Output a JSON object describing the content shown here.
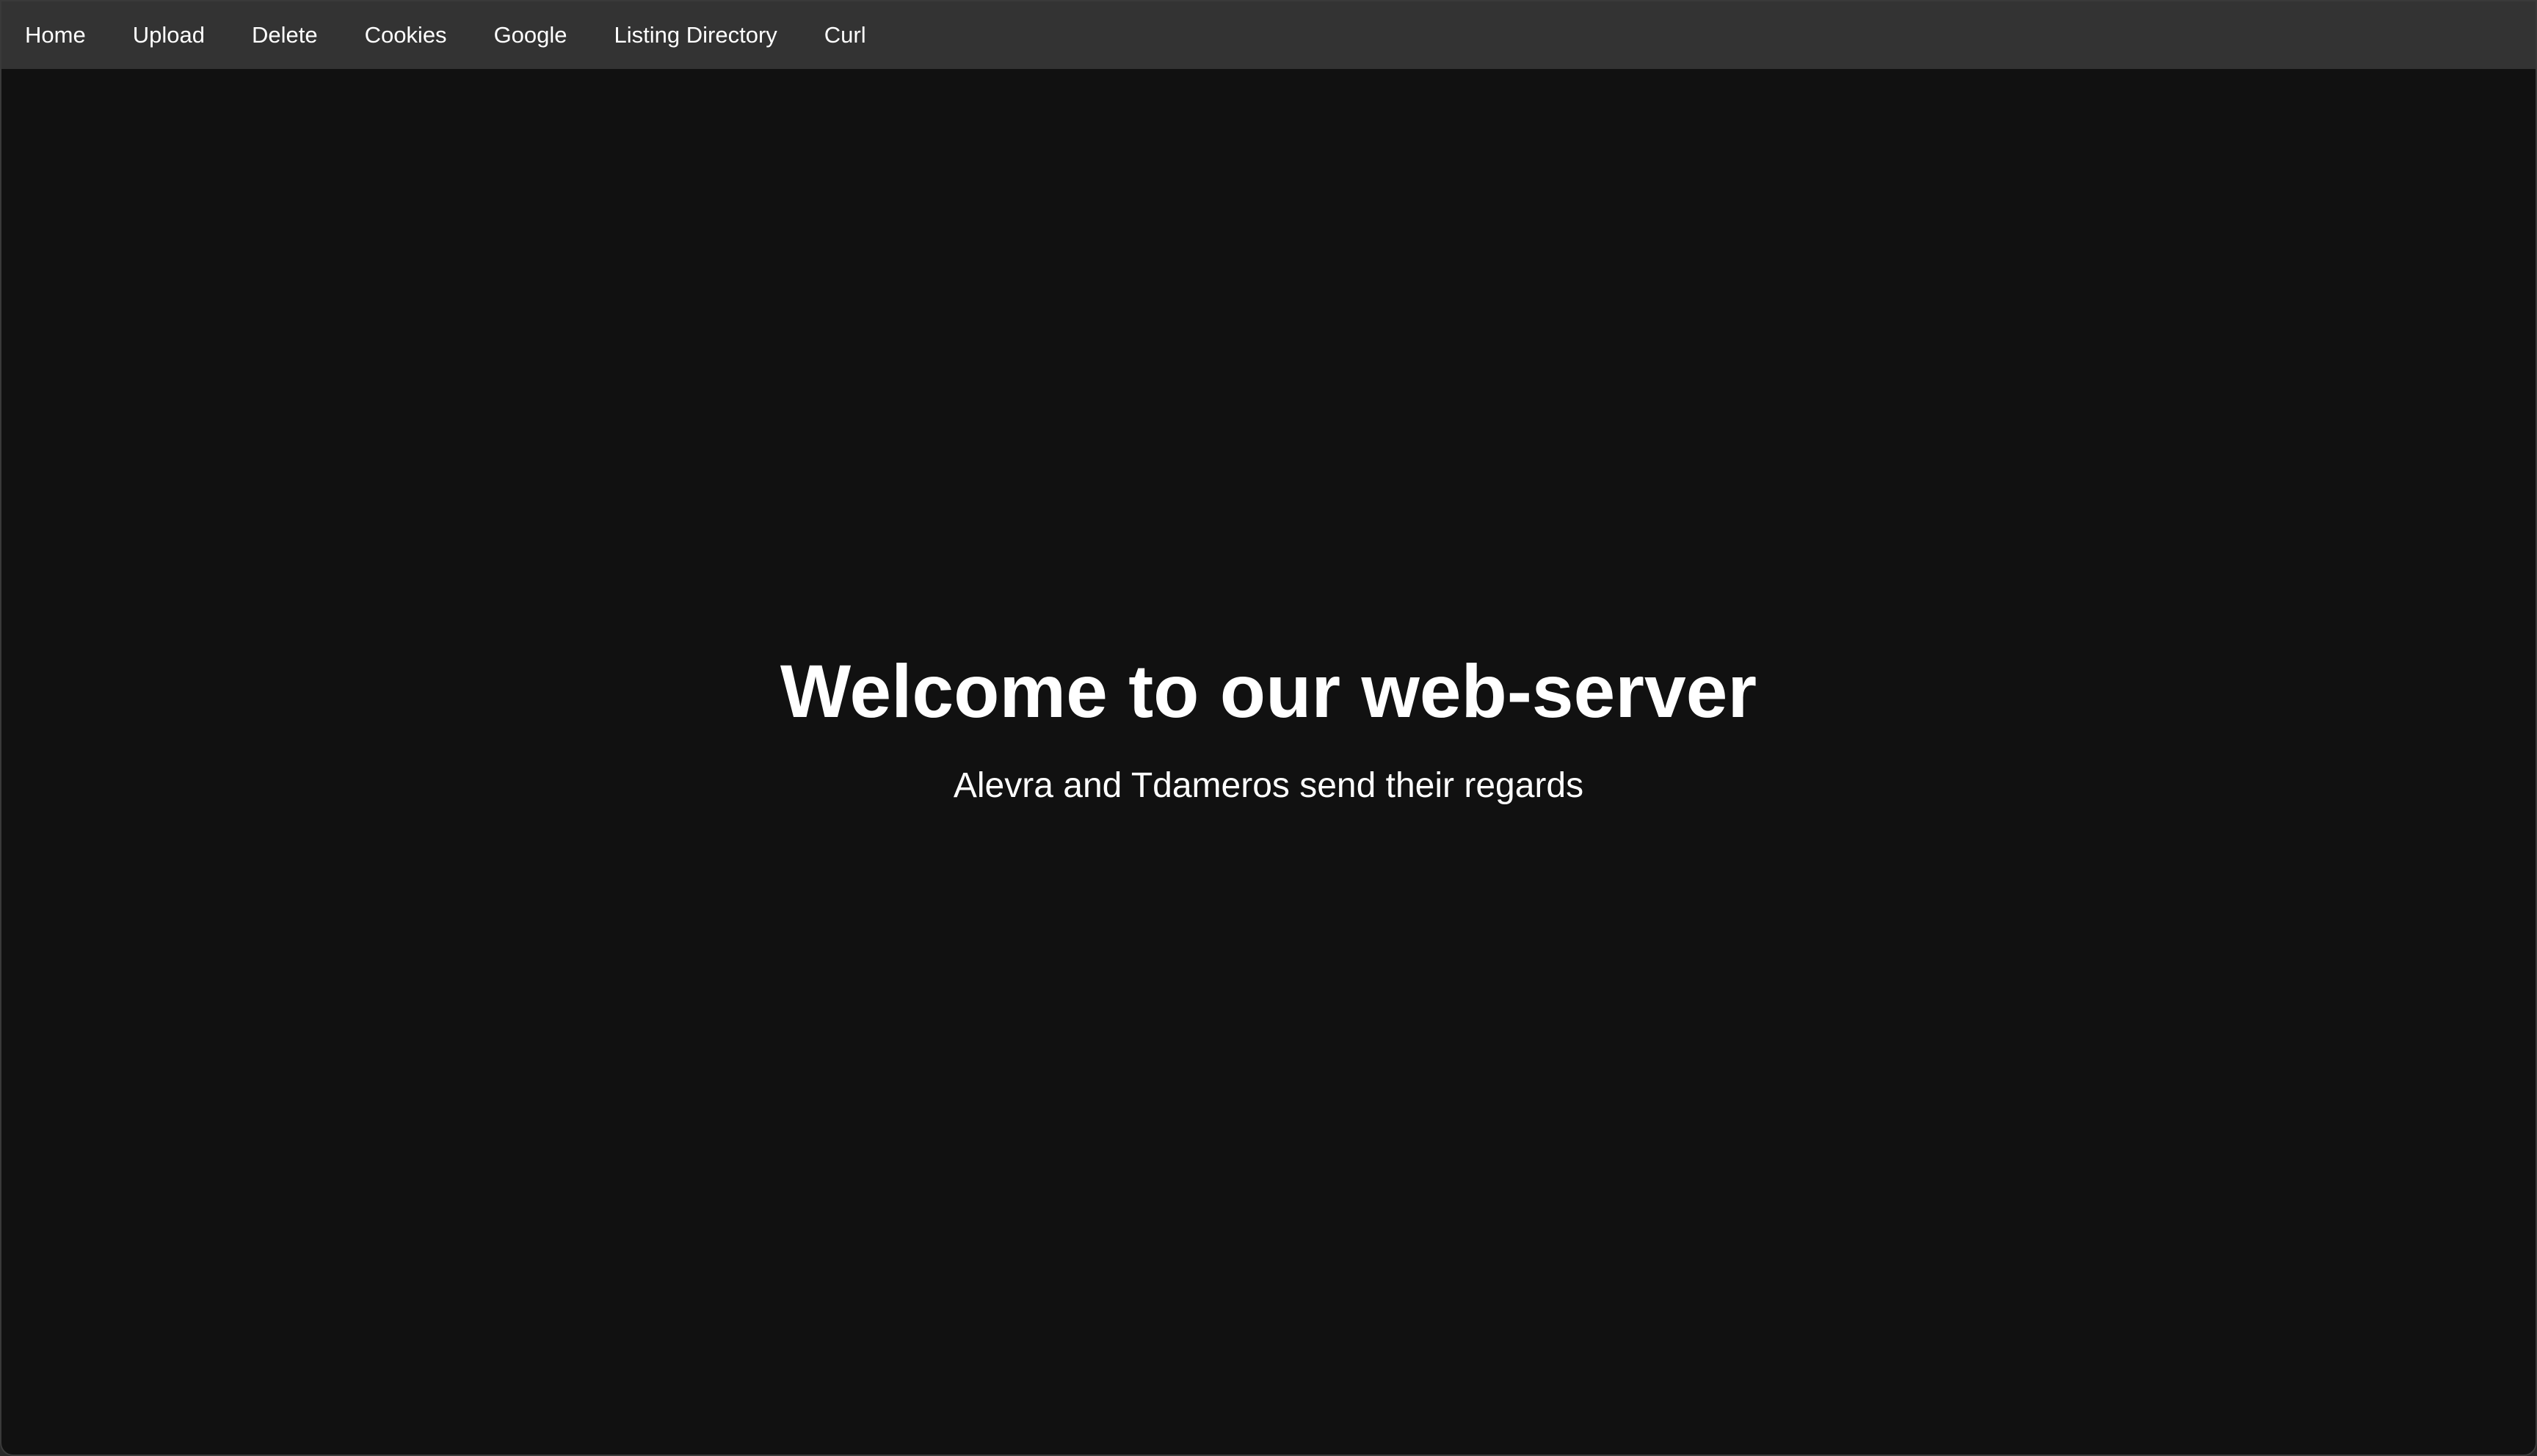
{
  "nav": {
    "items": [
      {
        "label": "Home",
        "name": "nav-home-link"
      },
      {
        "label": "Upload",
        "name": "nav-upload-link"
      },
      {
        "label": "Delete",
        "name": "nav-delete-link"
      },
      {
        "label": "Cookies",
        "name": "nav-cookies-link"
      },
      {
        "label": "Google",
        "name": "nav-google-link"
      },
      {
        "label": "Listing Directory",
        "name": "nav-listing-directory-link"
      },
      {
        "label": "Curl",
        "name": "nav-curl-link"
      }
    ]
  },
  "hero": {
    "title": "Welcome to our web-server",
    "subtitle": "Alevra and Tdameros send their regards"
  },
  "colors": {
    "page_background": "#111111",
    "navbar_background": "#333333",
    "text": "#ffffff"
  }
}
